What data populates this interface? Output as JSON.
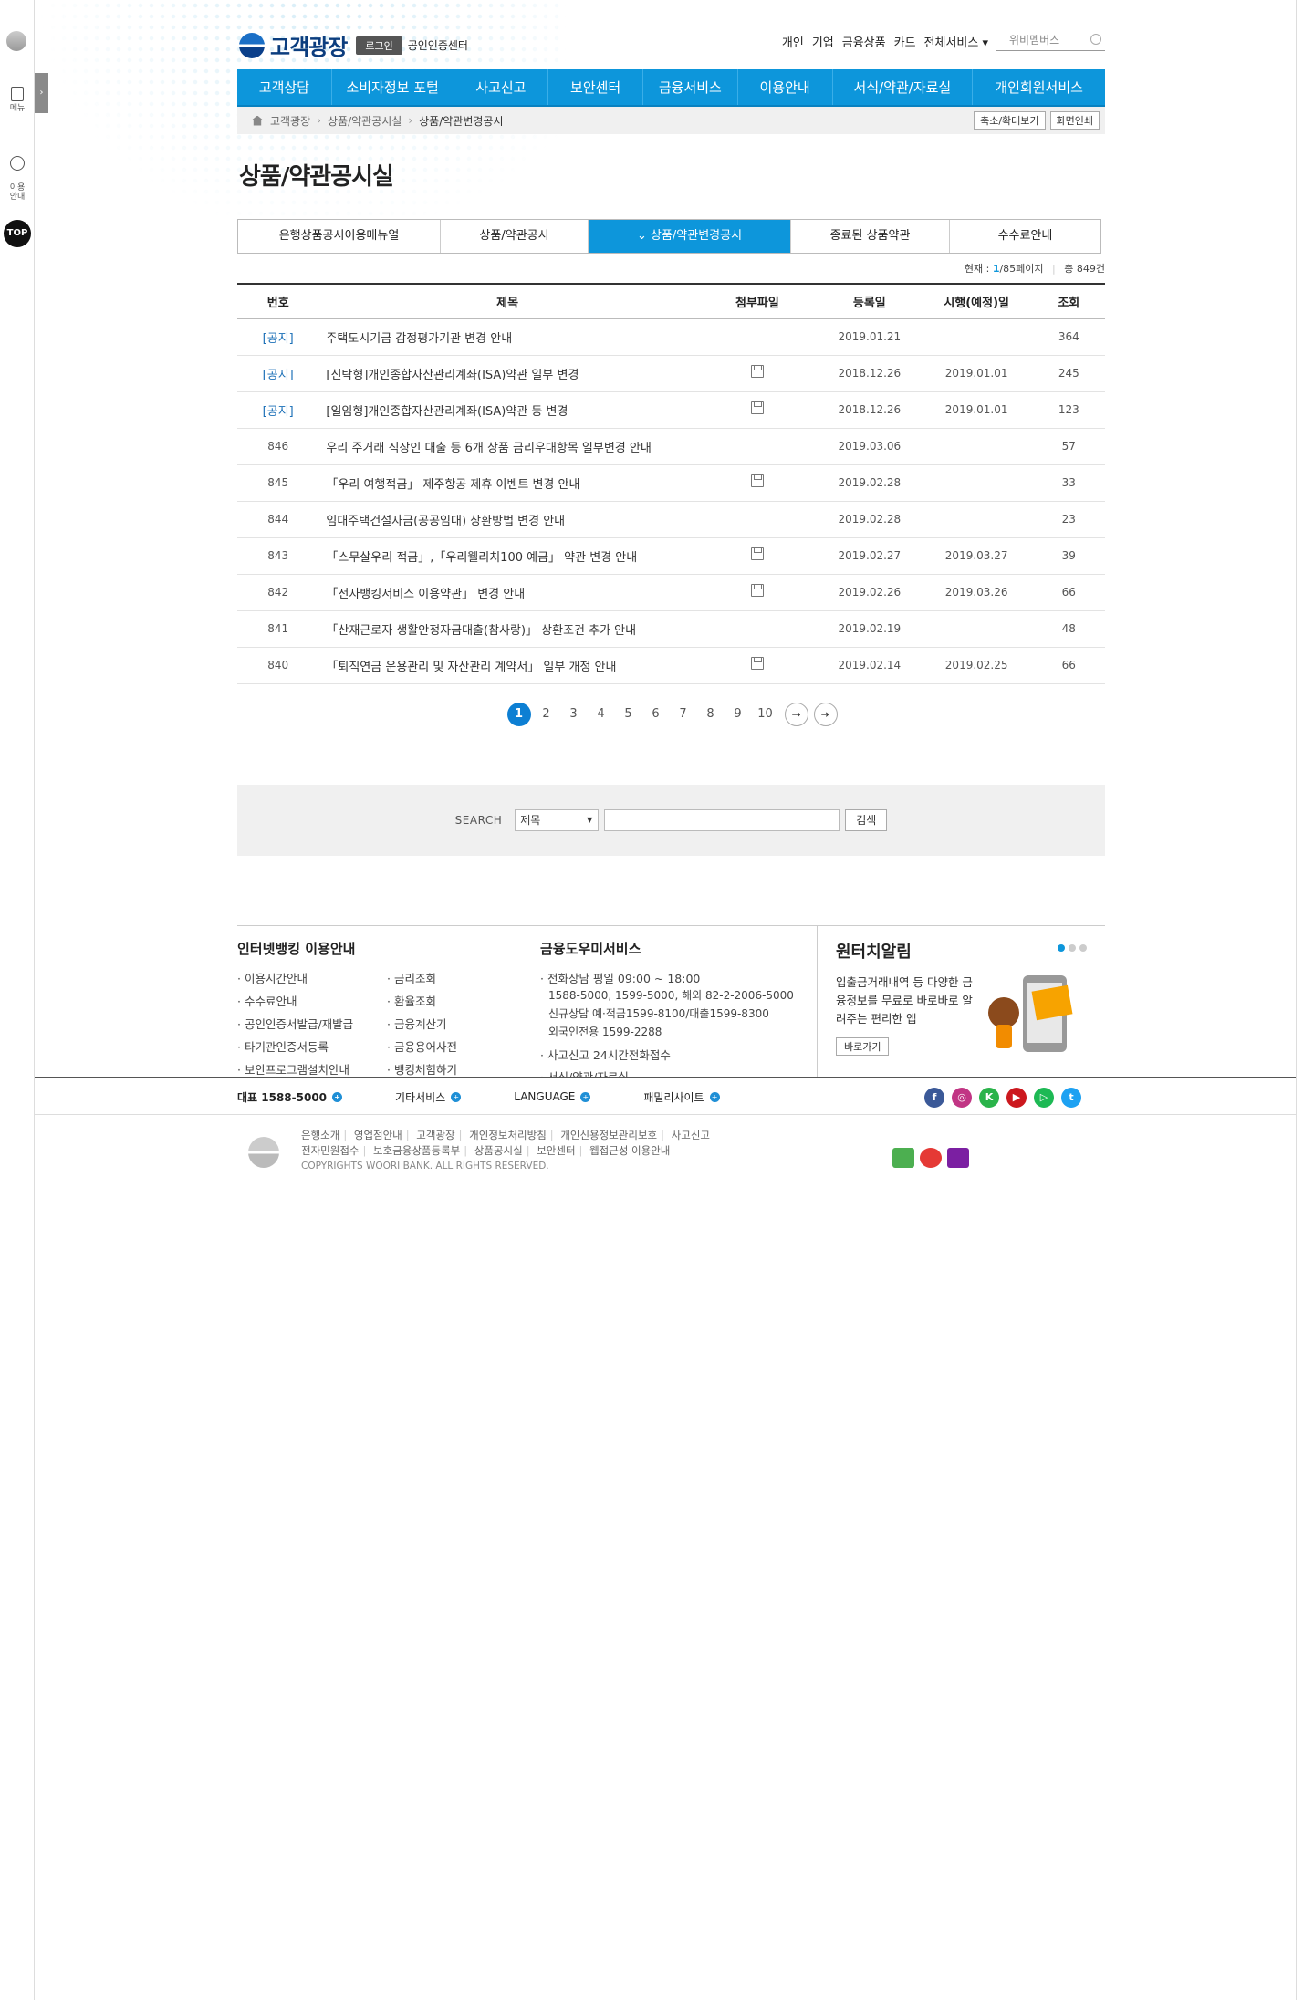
{
  "leftbar": {
    "menu_label": "메뉴",
    "guide_label": "이용\n안내",
    "top_label": "TOP",
    "toggle_label": "›"
  },
  "header": {
    "title": "고객광장",
    "login": "로그인",
    "cert_center": "공인인증센터",
    "util": [
      "개인",
      "기업",
      "금융상품",
      "카드",
      "전체서비스 ▾"
    ],
    "search_placeholder": "위비멤버스"
  },
  "gnb": [
    "고객상담",
    "소비자정보 포털",
    "사고신고",
    "보안센터",
    "금융서비스",
    "이용안내",
    "서식/약관/자료실",
    "개인회원서비스"
  ],
  "breadcrumb": {
    "items": [
      "고객광장",
      "상품/약관공시실",
      "상품/약관변경공시"
    ],
    "tools": [
      "축소/확대보기",
      "화면인쇄"
    ]
  },
  "page_title": "상품/약관공시실",
  "tabs": [
    "은행상품공시이용매뉴얼",
    "상품/약관공시",
    "상품/약관변경공시",
    "종료된 상품약관",
    "수수료안내"
  ],
  "active_tab_prefix": "⌄ ",
  "count": {
    "current_label": "현재 :",
    "current": "1",
    "total_pages": "/85페이지",
    "total": "총 849건"
  },
  "table": {
    "headers": [
      "번호",
      "제목",
      "첨부파일",
      "등록일",
      "시행(예정)일",
      "조회"
    ],
    "rows": [
      {
        "no": "[공지]",
        "title": "주택도시기금 감정평가기관 변경 안내",
        "file": false,
        "reg": "2019.01.21",
        "eff": "",
        "views": "364"
      },
      {
        "no": "[공지]",
        "title": "[신탁형]개인종합자산관리계좌(ISA)약관 일부 변경",
        "file": true,
        "reg": "2018.12.26",
        "eff": "2019.01.01",
        "views": "245"
      },
      {
        "no": "[공지]",
        "title": "[일임형]개인종합자산관리계좌(ISA)약관 등 변경",
        "file": true,
        "reg": "2018.12.26",
        "eff": "2019.01.01",
        "views": "123"
      },
      {
        "no": "846",
        "title": "우리 주거래 직장인 대출 등 6개 상품 금리우대항목 일부변경 안내",
        "file": false,
        "reg": "2019.03.06",
        "eff": "",
        "views": "57"
      },
      {
        "no": "845",
        "title": "「우리 여행적금」 제주항공 제휴 이벤트 변경 안내",
        "file": true,
        "reg": "2019.02.28",
        "eff": "",
        "views": "33"
      },
      {
        "no": "844",
        "title": "임대주택건설자금(공공임대) 상환방법 변경 안내",
        "file": false,
        "reg": "2019.02.28",
        "eff": "",
        "views": "23"
      },
      {
        "no": "843",
        "title": "「스무살우리 적금」,「우리웰리치100 예금」 약관 변경 안내",
        "file": true,
        "reg": "2019.02.27",
        "eff": "2019.03.27",
        "views": "39"
      },
      {
        "no": "842",
        "title": "「전자뱅킹서비스 이용약관」 변경 안내",
        "file": true,
        "reg": "2019.02.26",
        "eff": "2019.03.26",
        "views": "66"
      },
      {
        "no": "841",
        "title": "「산재근로자 생활안정자금대출(참사랑)」 상환조건 추가 안내",
        "file": false,
        "reg": "2019.02.19",
        "eff": "",
        "views": "48"
      },
      {
        "no": "840",
        "title": "「퇴직연금 운용관리 및 자산관리 계약서」 일부 개정 안내",
        "file": true,
        "reg": "2019.02.14",
        "eff": "2019.02.25",
        "views": "66"
      }
    ]
  },
  "pager": {
    "pages": [
      "1",
      "2",
      "3",
      "4",
      "5",
      "6",
      "7",
      "8",
      "9",
      "10"
    ],
    "next": "→",
    "last": "⇥"
  },
  "search": {
    "label": "SEARCH",
    "select": "제목",
    "button": "검색"
  },
  "info": {
    "col1": {
      "title": "인터넷뱅킹 이용안내",
      "items": [
        "이용시간안내",
        "금리조회",
        "수수료안내",
        "환율조회",
        "공인인증서발급/재발급",
        "금융계산기",
        "타기관인증서등록",
        "금융용어사전",
        "보안프로그램설치안내",
        "뱅킹체험하기"
      ]
    },
    "col2": {
      "title": "금융도우미서비스",
      "item1": "전화상담 평일 09:00 ~ 18:00",
      "sub1": "1588-5000, 1599-5000, 해외 82-2-2006-5000",
      "sub2": "신규상담 예·적금1599-8100/대출1599-8300",
      "sub3": "외국인전용 1599-2288",
      "item2": "사고신고 24시간전화접수",
      "item3": "서식/약관/자료실"
    },
    "col3": {
      "title": "원터치알림",
      "desc": "입출금거래내역 등 다양한 금융정보를 무료로 바로바로 알려주는 편리한 앱",
      "button": "바로가기"
    }
  },
  "footbar": {
    "items": [
      "대표 1588-5000",
      "기타서비스",
      "LANGUAGE",
      "패밀리사이트"
    ],
    "sns": [
      "f",
      "◎",
      "K",
      "▶",
      "▷",
      "t"
    ],
    "sns_colors": [
      "#3b5998",
      "#c13584",
      "#2ab34a",
      "#cc181e",
      "#1db954",
      "#1da1f2"
    ]
  },
  "copyright": {
    "line1": [
      "은행소개",
      "영업점안내",
      "고객광장",
      "개인정보처리방침",
      "개인신용정보관리보호",
      "사고신고"
    ],
    "line2": [
      "전자민원접수",
      "보호금융상품등록부",
      "상품공시실",
      "보안센터",
      "웹접근성 이용안내"
    ],
    "line3": "COPYRIGHTS WOORI BANK. ALL RIGHTS RESERVED."
  },
  "colors": {
    "primary": "#0d96db",
    "notice": "#1a6fb7",
    "pager_active": "#0d7fd3"
  }
}
